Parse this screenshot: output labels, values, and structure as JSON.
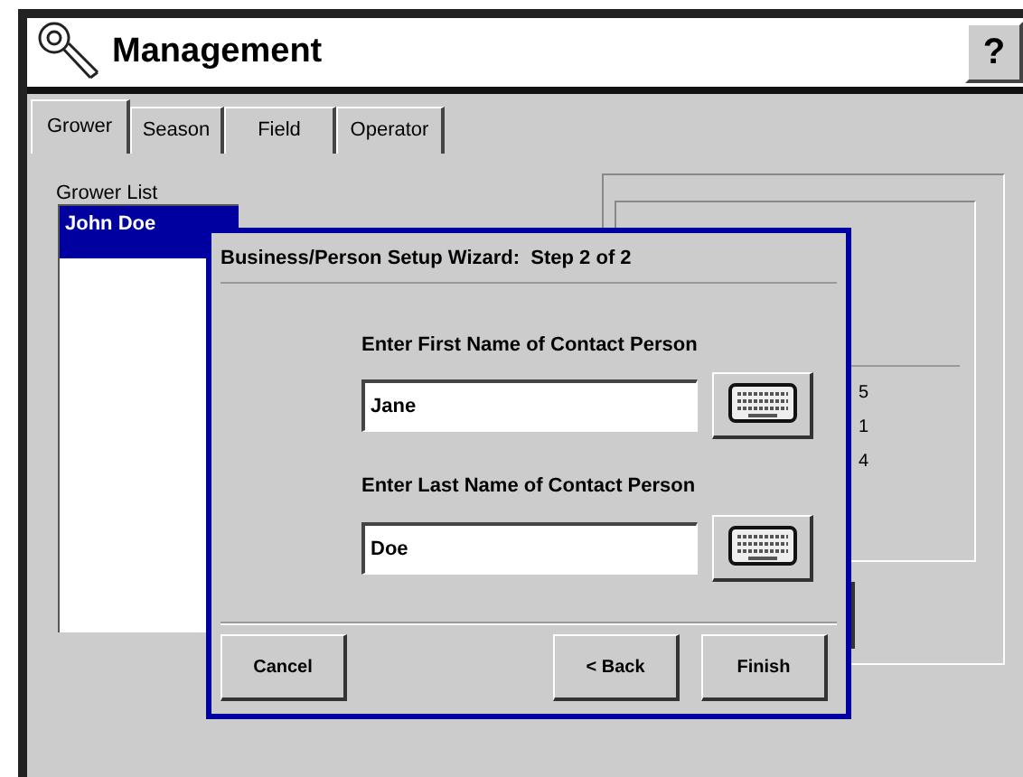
{
  "window": {
    "title": "Management",
    "help_button": "?"
  },
  "tabs": [
    {
      "label": "Grower",
      "selected": true
    },
    {
      "label": "Season",
      "selected": false
    },
    {
      "label": "Field",
      "selected": false
    },
    {
      "label": "Operator",
      "selected": false
    }
  ],
  "grower_list": {
    "label": "Grower List",
    "items": [
      {
        "name": "John Doe",
        "selected": true
      }
    ]
  },
  "background_panel": {
    "values": [
      "5",
      "1",
      "4"
    ]
  },
  "dialog": {
    "title": "Business/Person Setup Wizard:  Step 2 of 2",
    "fields": [
      {
        "label": "Enter First Name of Contact Person",
        "value": "Jane"
      },
      {
        "label": "Enter Last Name of Contact Person",
        "value": "Doe"
      }
    ],
    "buttons": [
      {
        "label": "Cancel",
        "kind": "left"
      },
      {
        "label": "< Back",
        "kind": "right"
      },
      {
        "label": "Finish",
        "kind": "right"
      }
    ]
  }
}
